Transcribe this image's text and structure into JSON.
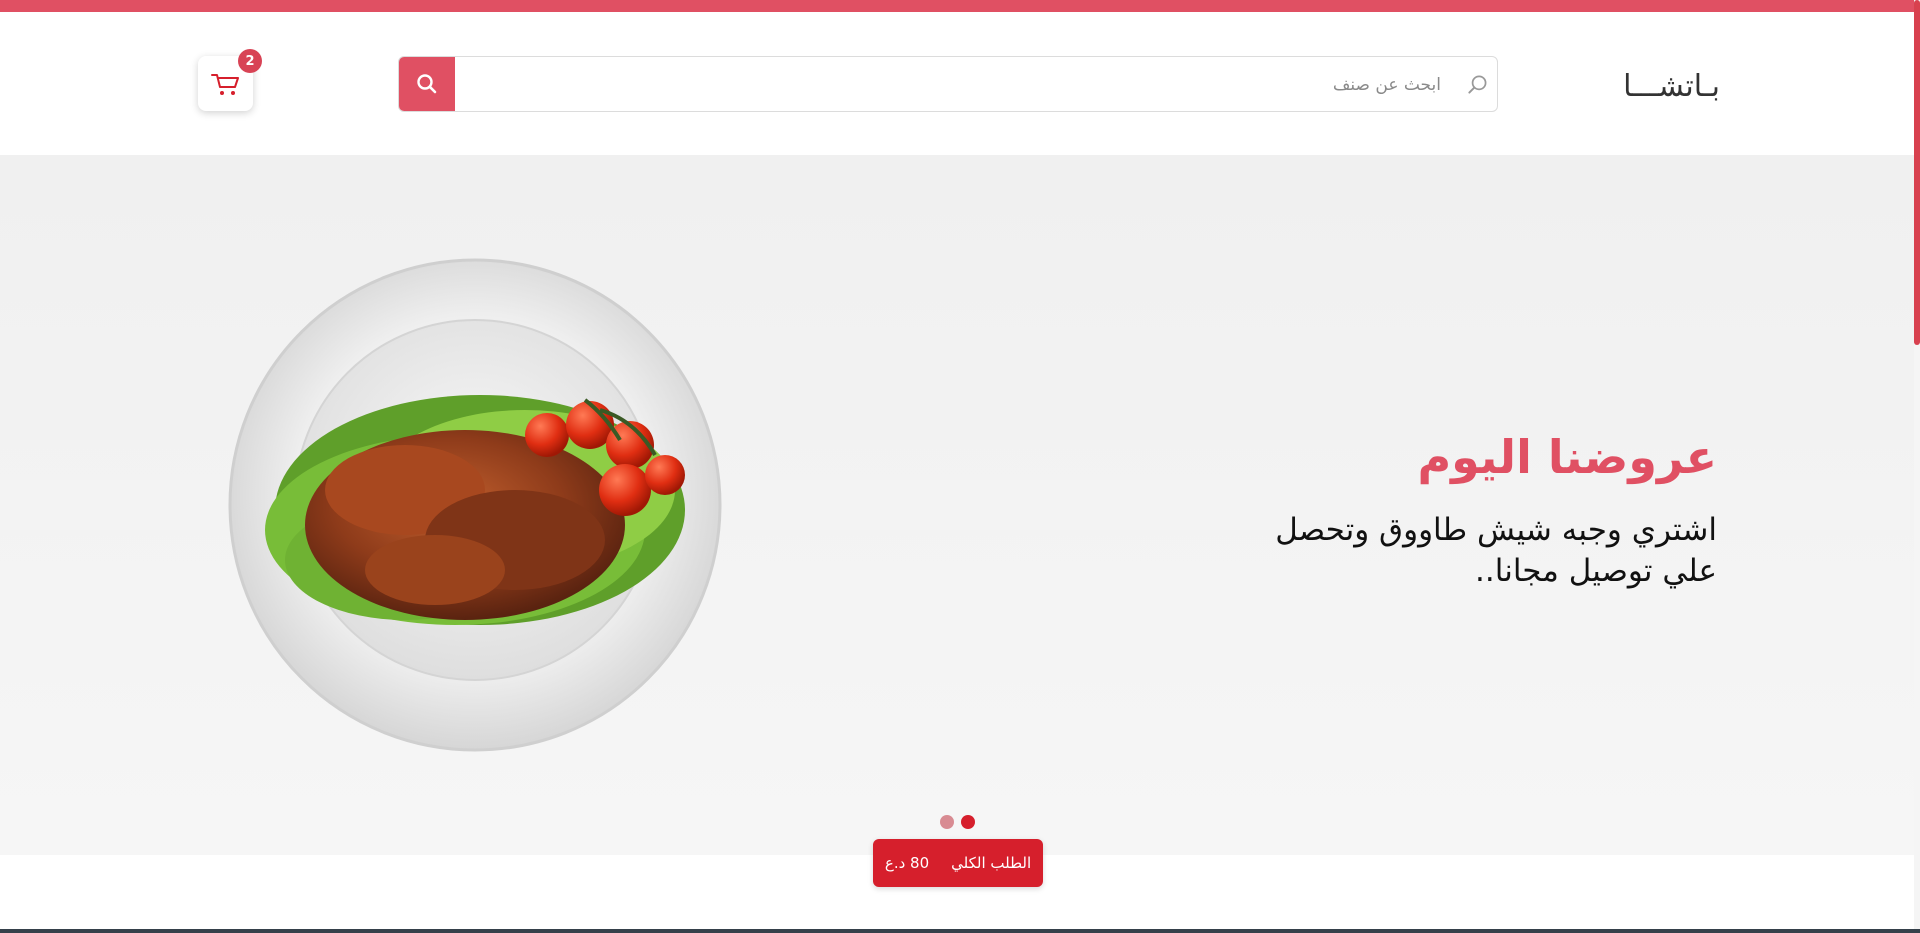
{
  "header": {
    "logo": "بـاتشـــا",
    "search": {
      "placeholder": "ابحث عن صنف",
      "value": ""
    },
    "cart": {
      "count": "2"
    }
  },
  "hero": {
    "title": "عروضنا اليوم",
    "text": "اشتري وجبه شيش طاووق وتحصل علي توصيل مجانا..",
    "slider": {
      "total_slides": 2,
      "active_slide": 2
    }
  },
  "order": {
    "label": "الطلب الكلي",
    "amount": "80 د.ع"
  },
  "colors": {
    "accent": "#e05063",
    "accent_dark": "#d61f2c",
    "hero_bg": "#f2f2f2"
  },
  "icons": {
    "search": "search-icon",
    "cart": "cart-icon"
  }
}
